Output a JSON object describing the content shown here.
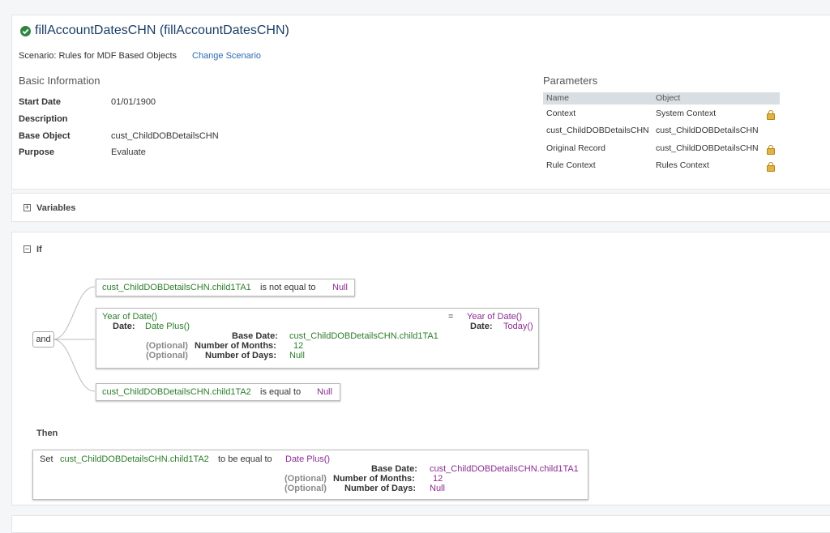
{
  "header": {
    "title": "fillAccountDatesCHN (fillAccountDatesCHN)",
    "scenario_label": "Scenario: Rules for MDF Based Objects",
    "change_scenario": "Change Scenario"
  },
  "basic_info": {
    "heading": "Basic Information",
    "rows": [
      {
        "label": "Start Date",
        "value": "01/01/1900"
      },
      {
        "label": "Description",
        "value": ""
      },
      {
        "label": "Base Object",
        "value": "cust_ChildDOBDetailsCHN"
      },
      {
        "label": "Purpose",
        "value": "Evaluate"
      }
    ]
  },
  "parameters": {
    "heading": "Parameters",
    "columns": [
      "Name",
      "Object"
    ],
    "rows": [
      {
        "name": "Context",
        "object": "System Context"
      },
      {
        "name": "cust_ChildDOBDetailsCHN",
        "object": "cust_ChildDOBDetailsCHN"
      },
      {
        "name": "Original Record",
        "object": "cust_ChildDOBDetailsCHN"
      },
      {
        "name": "Rule Context",
        "object": "Rules Context"
      }
    ]
  },
  "variables": {
    "label": "Variables",
    "expander": "+"
  },
  "if_section": {
    "label": "If",
    "expander": "−",
    "and_label": "and",
    "cond1": {
      "field": "cust_ChildDOBDetailsCHN.child1TA1",
      "op": "is not equal to",
      "value": "Null"
    },
    "cond2": {
      "left_func": "Year of Date()",
      "date_label": "Date:",
      "date_func": "Date Plus()",
      "base_date_label": "Base Date:",
      "base_date_value": "cust_ChildDOBDetailsCHN.child1TA1",
      "optional": "(Optional)",
      "months_label": "Number of Months:",
      "months_value": "12",
      "days_label": "Number of Days:",
      "days_value": "Null",
      "equals": "=",
      "right_func": "Year of Date()",
      "right_date_label": "Date:",
      "right_date_func": "Today()"
    },
    "cond3": {
      "field": "cust_ChildDOBDetailsCHN.child1TA2",
      "op": "is equal to",
      "value": "Null"
    }
  },
  "then_section": {
    "label": "Then",
    "set_label": "Set",
    "field": "cust_ChildDOBDetailsCHN.child1TA2",
    "op": "to be equal to",
    "func": "Date Plus()",
    "base_date_label": "Base Date:",
    "base_date_value": "cust_ChildDOBDetailsCHN.child1TA1",
    "optional": "(Optional)",
    "months_label": "Number of Months:",
    "months_value": "12",
    "days_label": "Number of Days:",
    "days_value": "Null"
  },
  "colors": {
    "green": "#2b7d2b",
    "purple": "#8b2b91",
    "link": "#2c6cb0",
    "status": "#2e8540"
  }
}
